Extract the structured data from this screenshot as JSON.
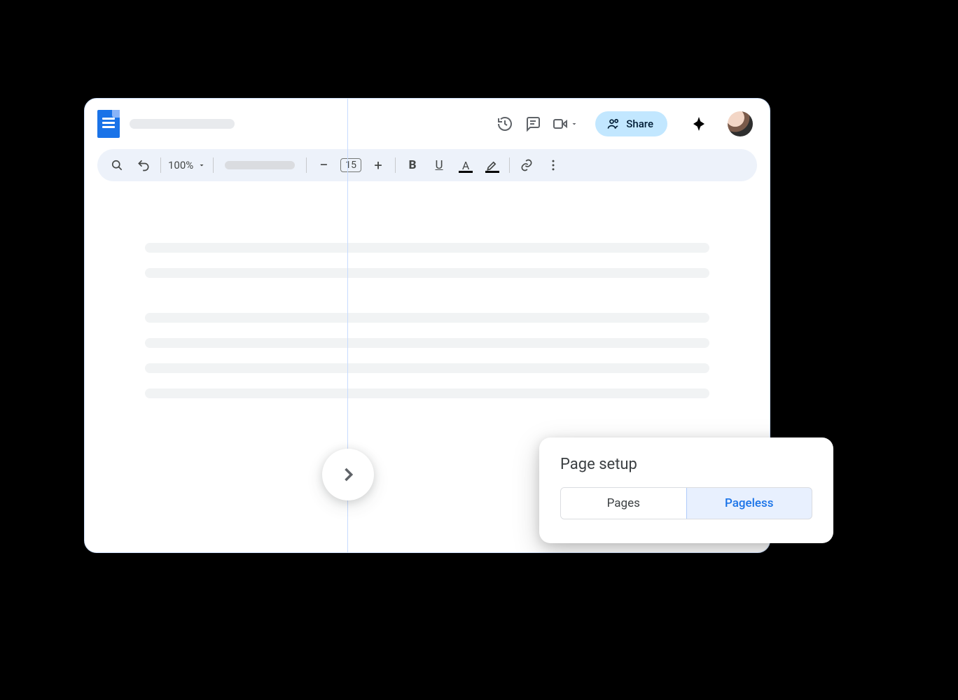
{
  "header": {
    "share_label": "Share"
  },
  "toolbar": {
    "zoom": "100%",
    "font_size": "15"
  },
  "popup": {
    "title": "Page setup",
    "pages_label": "Pages",
    "pageless_label": "Pageless",
    "selected": "pageless"
  }
}
